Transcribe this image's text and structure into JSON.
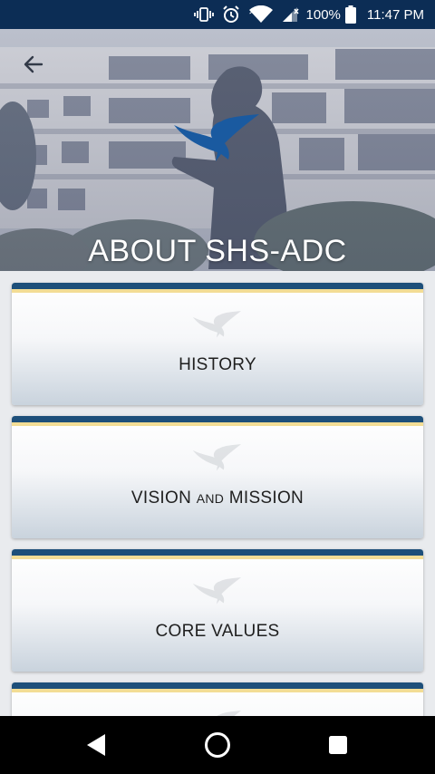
{
  "status_bar": {
    "battery_percent": "100%",
    "time": "11:47 PM",
    "icons": [
      "vibrate-icon",
      "alarm-icon",
      "wifi-icon",
      "cellular-signal-icon",
      "battery-icon"
    ]
  },
  "header": {
    "title": "ABOUT SHS-ADC",
    "back_icon": "arrow-left-icon",
    "logo_icon": "eagle-logo-icon"
  },
  "cards": [
    {
      "label": "HISTORY"
    },
    {
      "label_part1": "VISION ",
      "label_small": "AND",
      "label_part2": " MISSION"
    },
    {
      "label": "CORE VALUES"
    },
    {
      "label": ""
    }
  ],
  "nav": {
    "back_icon": "nav-back-icon",
    "home_icon": "nav-home-icon",
    "recents_icon": "nav-recents-icon"
  },
  "colors": {
    "status_bar": "#0c2d55",
    "card_bar_blue": "#1d4f7a",
    "card_bar_gold": "#f3dd95",
    "logo_blue": "#1a5aa0"
  }
}
